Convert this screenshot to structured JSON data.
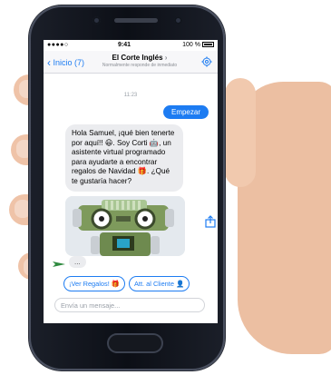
{
  "status": {
    "signal": "●●●●○ ",
    "time": "9:41",
    "battery_text": "100 %"
  },
  "nav": {
    "back_label": "Inicio (7)",
    "title": "El Corte Inglés",
    "subtitle": "Normalmente responde de inmediato"
  },
  "chat": {
    "timestamp": "11:23",
    "user_message": "Empezar",
    "bot_message": "Hola Samuel, ¡qué bien tenerte por aquí!! 😃. Soy Corti 🤖, un asistente virtual programado para ayudarte a encontrar regalos de Navidad 🎁. ¿Qué te gustaría hacer?",
    "typing_indicator": "...",
    "quick_replies": [
      "¡Ver Regalos! 🎁",
      "Att. al Cliente 👤"
    ]
  },
  "composer": {
    "placeholder": "Envía un mensaje..."
  },
  "colors": {
    "accent": "#1d7cf2",
    "bubble_grey": "#ebecef"
  }
}
